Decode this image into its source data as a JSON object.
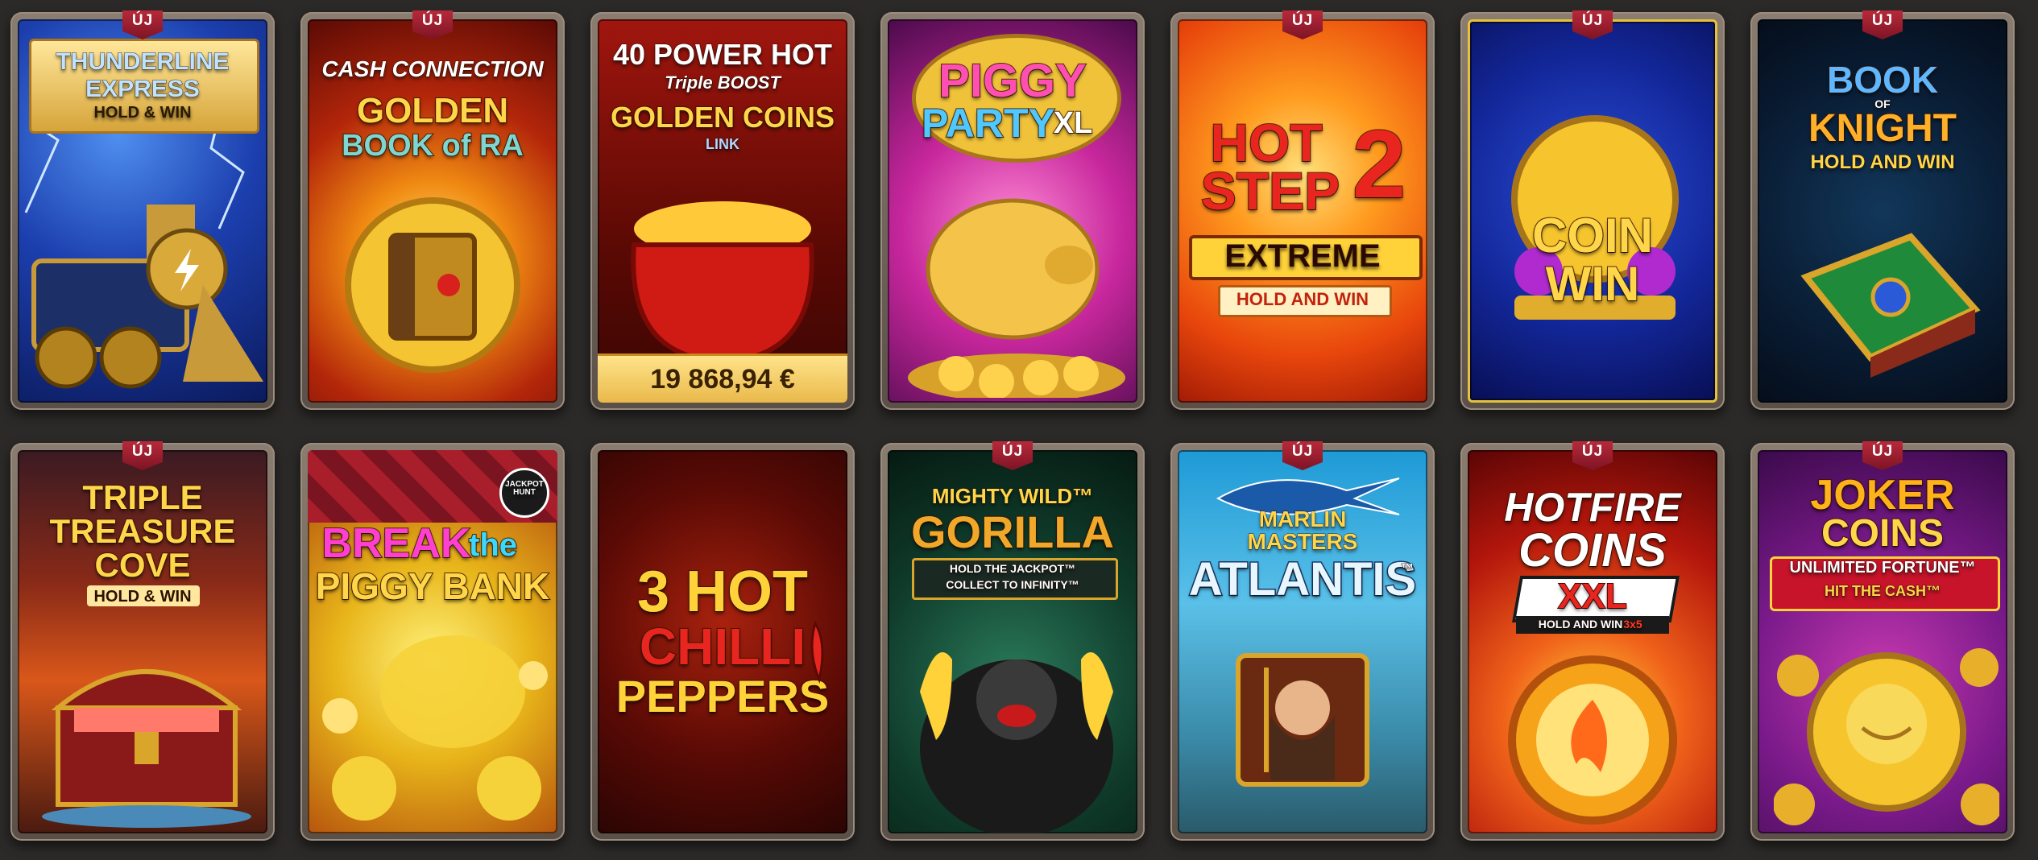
{
  "badge_label": "ÚJ",
  "games": [
    {
      "name": "thunderline-express",
      "badge": true,
      "lines": [
        "THUNDERLINE",
        "EXPRESS",
        "HOLD & WIN"
      ]
    },
    {
      "name": "golden-book-of-ra",
      "badge": true,
      "lines": [
        "CASH CONNECTION",
        "GOLDEN",
        "BOOK of RA"
      ]
    },
    {
      "name": "40-power-hot",
      "badge": false,
      "lines": [
        "40 POWER HOT",
        "Triple BOOST",
        "GOLDEN COINS",
        "LINK"
      ],
      "jackpot": "19 868,94 €"
    },
    {
      "name": "piggy-party-xl",
      "badge": false,
      "lines": [
        "PIGGY",
        "PARTY",
        "XL"
      ]
    },
    {
      "name": "hot-step-2-extreme",
      "badge": true,
      "lines": [
        "HOT",
        "STEP",
        "2",
        "EXTREME",
        "HOLD AND WIN"
      ]
    },
    {
      "name": "coin-win",
      "badge": true,
      "lines": [
        "COIN",
        "WIN"
      ]
    },
    {
      "name": "book-of-knight",
      "badge": true,
      "lines": [
        "BOOK",
        "OF",
        "KNIGHT",
        "HOLD AND WIN"
      ]
    },
    {
      "name": "triple-treasure-cove",
      "badge": true,
      "lines": [
        "TRIPLE",
        "TREASURE",
        "COVE",
        "HOLD & WIN"
      ]
    },
    {
      "name": "break-the-piggy-bank",
      "badge": false,
      "lines": [
        "BREAK",
        "the",
        "PIGGY BANK",
        "JACKPOT HUNT"
      ]
    },
    {
      "name": "3-hot-chilli-peppers",
      "badge": false,
      "lines": [
        "3 HOT",
        "CHILLI",
        "PEPPERS"
      ]
    },
    {
      "name": "mighty-wild-gorilla",
      "badge": true,
      "lines": [
        "MIGHTY WILD™",
        "GORILLA",
        "HOLD THE JACKPOT™",
        "COLLECT TO INFINITY™"
      ]
    },
    {
      "name": "marlin-masters-atlantis",
      "badge": true,
      "lines": [
        "MARLIN",
        "MASTERS",
        "ATLANTIS",
        "™"
      ]
    },
    {
      "name": "hotfire-coins-xxl",
      "badge": true,
      "lines": [
        "HOTFIRE",
        "COINS",
        "XXL",
        "HOLD AND WIN",
        "3x5"
      ]
    },
    {
      "name": "joker-coins",
      "badge": true,
      "lines": [
        "JOKER",
        "COINS",
        "UNLIMITED FORTUNE™",
        "HIT THE CASH™"
      ]
    }
  ]
}
